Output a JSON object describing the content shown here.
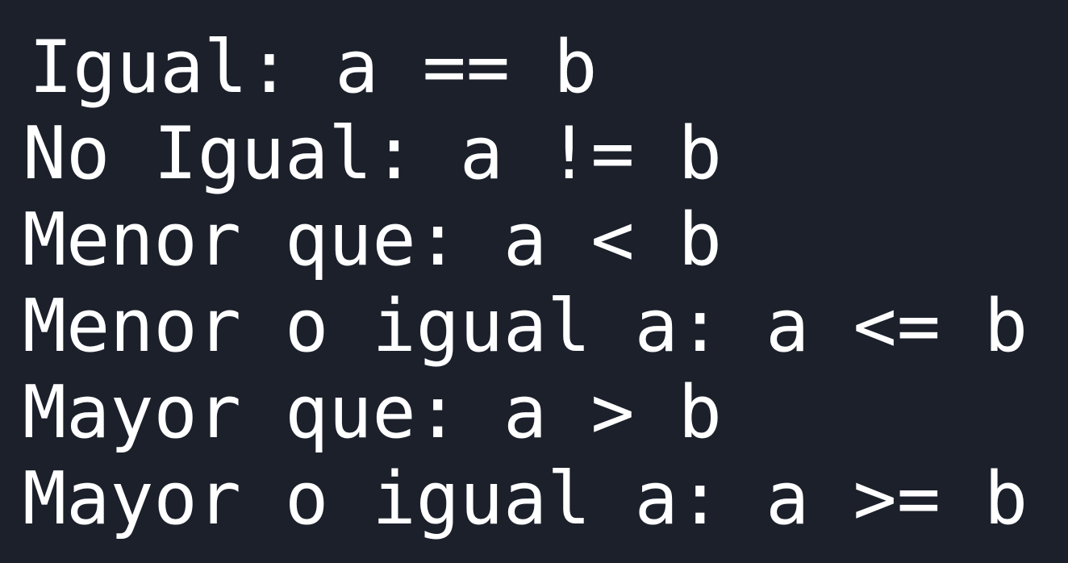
{
  "lines": [
    "Igual: a == b",
    "No Igual: a != b",
    "Menor que: a < b",
    "Menor o igual a: a <= b",
    "Mayor que: a > b",
    "Mayor o igual a: a >= b"
  ],
  "colors": {
    "background": "#1b202b",
    "text": "#ffffff"
  }
}
